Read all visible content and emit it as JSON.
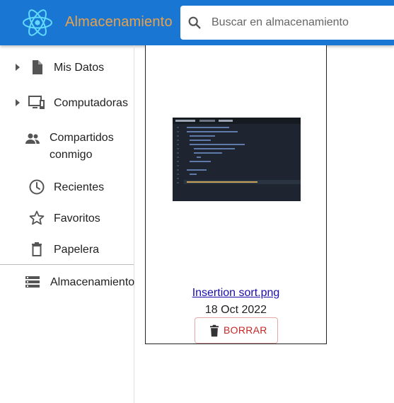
{
  "header": {
    "title": "Almacenamiento",
    "search_placeholder": "Buscar en almacenamiento"
  },
  "sidebar": {
    "items": [
      {
        "label": "Mis Datos",
        "icon": "file-icon",
        "expandable": true
      },
      {
        "label": "Computadoras",
        "icon": "computer-icon",
        "expandable": true
      },
      {
        "label": "Compartidos conmigo",
        "icon": "people-icon",
        "expandable": false
      },
      {
        "label": "Recientes",
        "icon": "clock-icon",
        "expandable": false
      },
      {
        "label": "Favoritos",
        "icon": "star-icon",
        "expandable": false
      },
      {
        "label": "Papelera",
        "icon": "trash-icon",
        "expandable": false
      },
      {
        "label": "Almacenamiento",
        "icon": "storage-icon",
        "expandable": false
      }
    ]
  },
  "file": {
    "name": "Insertion sort.png",
    "date": "18 Oct 2022",
    "delete_label": "BORRAR"
  },
  "colors": {
    "appbar": "#1976d2",
    "title": "#e8a24a",
    "delete": "#c62828",
    "link": "#1a0dab"
  }
}
